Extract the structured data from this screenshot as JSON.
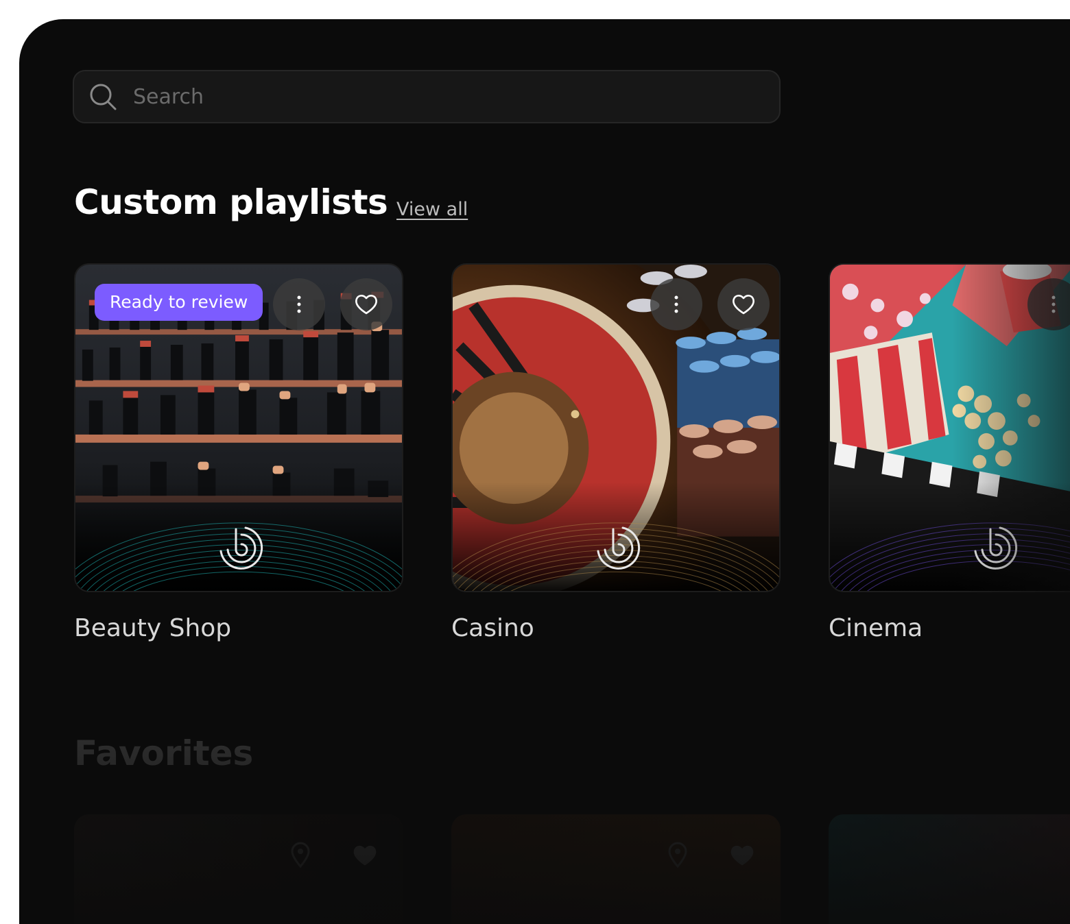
{
  "search": {
    "placeholder": "Search",
    "value": "",
    "icon": "search-icon"
  },
  "custom_playlists": {
    "title": "Custom playlists",
    "view_all_label": "View all",
    "cards": [
      {
        "name": "Beauty Shop",
        "badge": "Ready to review",
        "theme": "lipstick shelves",
        "accent": "#1fb7b7"
      },
      {
        "name": "Casino",
        "badge": "",
        "theme": "roulette wheel and chips",
        "accent": "#b08a4a"
      },
      {
        "name": "Cinema",
        "badge": "",
        "theme": "popcorn and clapperboard",
        "accent": "#6a4bd1"
      }
    ]
  },
  "favorites": {
    "title": "Favorites"
  },
  "colors": {
    "background": "#0b0b0b",
    "badge": "#7c5cff",
    "search_bg": "#171717",
    "text_primary": "#ffffff",
    "text_secondary": "#d8d8d8"
  }
}
